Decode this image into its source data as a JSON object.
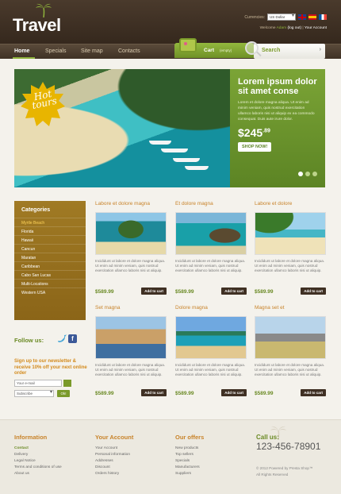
{
  "header": {
    "logo": "Travel",
    "currency_label": "Currencies:",
    "currency_selected": "US Dollar",
    "welcome_text": "Welcome",
    "user_name": "Adam",
    "logout": "(log out)",
    "account": "Your Account"
  },
  "nav": {
    "items": [
      "Home",
      "Specials",
      "Site map",
      "Contacts"
    ],
    "cart_label": "Cart",
    "cart_sub": "(empty)",
    "search_label": "Search"
  },
  "slider": {
    "badge": "Hot tours",
    "title": "Lorem ipsum dolor sit amet conse",
    "text": "Lorem et dolore magna aliqua. Ut enim ad minim veniam, quis nostrud exercitation ullamco laboris nisi ut aliquip ex ea commodo consequat. Duis aute irure dolor.",
    "price_main": "$245",
    "price_cents": ".89",
    "button": "SHOP NOW!"
  },
  "sidebar": {
    "categories_title": "Categories",
    "categories": [
      "Myrtle Beach",
      "Florida",
      "Hawaii",
      "Cancun",
      "Maratan",
      "Caribbean",
      "Cabo San Lucas",
      "Multi-Locations",
      "Western USA"
    ],
    "follow": "Follow us:",
    "signup": "Sign up to our newsletter & receive 10% off your next online order",
    "email_placeholder": "Your e-mail",
    "subscribe_option": "Subscribe",
    "ok": "Ok!"
  },
  "products": [
    {
      "title": "Labore et dolore magna",
      "desc": "Incididunt ut labore et dolore magna aliqua. Ut enim ad minim veniam, quis nostrud exercitation ullamco laboris nisi ut aliquip.",
      "price": "$589.99",
      "btn": "Add to cart"
    },
    {
      "title": "Et dolore magna",
      "desc": "Incididunt ut labore et dolore magna aliqua. Ut enim ad minim veniam, quis nostrud exercitation ullamco laboris nisi ut aliquip.",
      "price": "$589.99",
      "btn": "Add to cart"
    },
    {
      "title": "Labore et dolore",
      "desc": "Incididunt ut labore et dolore magna aliqua. Ut enim ad minim veniam, quis nostrud exercitation ullamco laboris nisi ut aliquip.",
      "price": "$589.99",
      "btn": "Add to cart"
    },
    {
      "title": "Set magna",
      "desc": "Incididunt ut labore et dolore magna aliqua. Ut enim ad minim veniam, quis nostrud exercitation ullamco laboris nisi ut aliquip.",
      "price": "$589.99",
      "btn": "Add to cart"
    },
    {
      "title": "Dolore magna",
      "desc": "Incididunt ut labore et dolore magna aliqua. Ut enim ad minim veniam, quis nostrud exercitation ullamco laboris nisi ut aliquip.",
      "price": "$589.99",
      "btn": "Add to cart"
    },
    {
      "title": "Magna set et",
      "desc": "Incididunt ut labore et dolore magna aliqua. Ut enim ad minim veniam, quis nostrud exercitation ullamco laboris nisi ut aliquip.",
      "price": "$589.99",
      "btn": "Add to cart"
    }
  ],
  "footer": {
    "info_title": "Information",
    "info_links": [
      "Contact",
      "Delivery",
      "Legal Notice",
      "Terms and conditions of use",
      "About us"
    ],
    "account_title": "Your Account",
    "account_links": [
      "Your Account",
      "Personal information",
      "Addresses",
      "Discount",
      "Orders history"
    ],
    "offers_title": "Our offers",
    "offers_links": [
      "New products",
      "Top sellers",
      "Specials",
      "Manufacturers",
      "Suppliers"
    ],
    "call_us": "Call us:",
    "phone": "123-456-78901",
    "copyright": "© 2012 Powered by Presta Shop™",
    "rights": "All Rights Reserved"
  }
}
